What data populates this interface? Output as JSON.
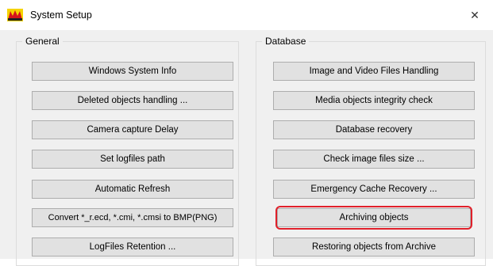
{
  "window": {
    "title": "System Setup",
    "close_glyph": "✕"
  },
  "general": {
    "label": "General",
    "buttons": [
      "Windows System Info",
      "Deleted objects handling ...",
      "Camera capture Delay",
      "Set logfiles path",
      "Automatic Refresh",
      "Convert *_r.ecd, *.cmi, *.cmsi to BMP(PNG)",
      "LogFiles Retention ..."
    ]
  },
  "database": {
    "label": "Database",
    "buttons": [
      "Image and Video Files Handling",
      "Media objects integrity check",
      "Database recovery",
      "Check image files size ...",
      "Emergency Cache Recovery ...",
      "Archiving objects",
      "Restoring objects from Archive"
    ]
  },
  "highlighted_button": "Archiving objects",
  "colors": {
    "highlight": "#e0202a",
    "button_face": "#e1e1e1",
    "window_bg": "#f0f0f0"
  },
  "icons": {
    "app": "red-yellow-app-logo-icon",
    "close": "close-icon"
  }
}
